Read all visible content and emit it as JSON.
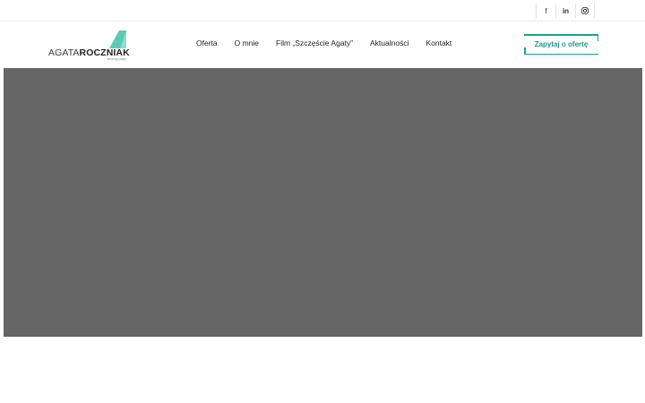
{
  "topbar": {
    "socials": [
      {
        "icon": "facebook-icon",
        "label": "f"
      },
      {
        "icon": "linkedin-icon",
        "label": "in"
      },
      {
        "icon": "instagram-icon",
        "label": ""
      }
    ]
  },
  "logo": {
    "light": "AGATA",
    "bold": "ROCZNIAK",
    "tagline": "zmienię pasje",
    "accent_color": "#5ec9b3"
  },
  "nav": {
    "items": [
      "Oferta",
      "O mnie",
      "Film „Szczęście Agaty”",
      "Aktualności",
      "Kontakt"
    ]
  },
  "cta": {
    "label": "Zapytaj o ofertę",
    "color": "#1aa08c"
  },
  "hero": {
    "background": "#666666"
  }
}
